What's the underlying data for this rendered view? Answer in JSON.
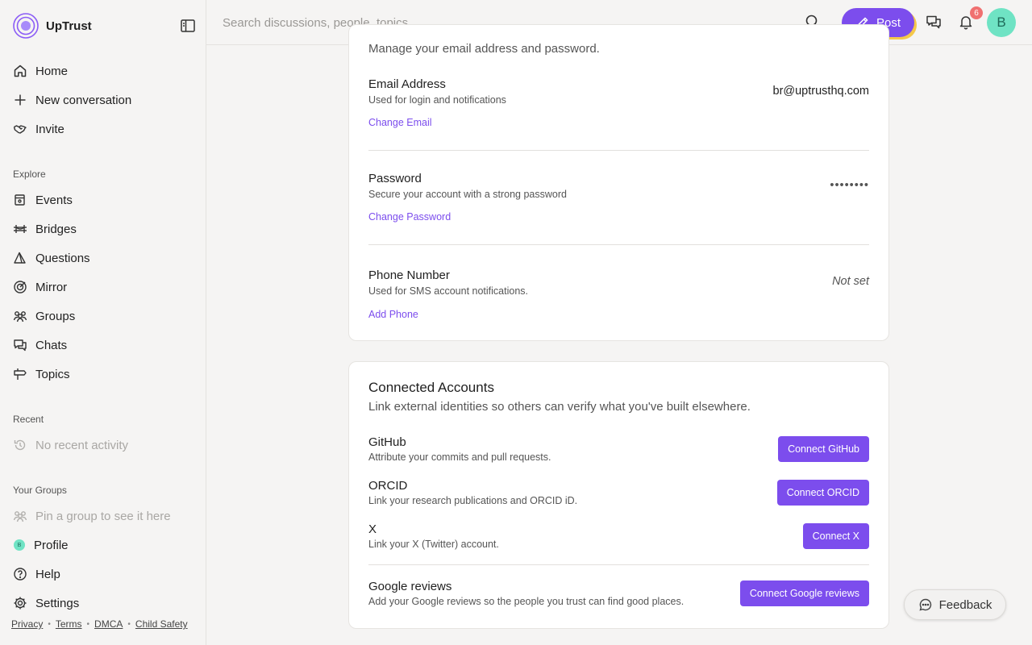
{
  "app": {
    "name": "UpTrust"
  },
  "colors": {
    "accent": "#7c4ded",
    "avatar": "#6fe3c4",
    "badge": "#f07070",
    "post_shadow": "#f5c84a"
  },
  "sidebar": {
    "main_items": [
      {
        "label": "Home",
        "icon": "home-icon"
      },
      {
        "label": "New conversation",
        "icon": "plus-icon"
      },
      {
        "label": "Invite",
        "icon": "handshake-icon"
      }
    ],
    "explore_label": "Explore",
    "explore_items": [
      {
        "label": "Events",
        "icon": "calendar-icon"
      },
      {
        "label": "Bridges",
        "icon": "bridge-icon"
      },
      {
        "label": "Questions",
        "icon": "question-icon"
      },
      {
        "label": "Mirror",
        "icon": "target-icon"
      },
      {
        "label": "Groups",
        "icon": "group-icon"
      },
      {
        "label": "Chats",
        "icon": "chat-icon"
      },
      {
        "label": "Topics",
        "icon": "signpost-icon"
      }
    ],
    "recent_label": "Recent",
    "recent_empty": "No recent activity",
    "groups_label": "Your Groups",
    "groups_empty": "Pin a group to see it here",
    "bottom_items": [
      {
        "label": "Profile",
        "icon": "avatar",
        "avatar_letter": "B"
      },
      {
        "label": "Help",
        "icon": "help-icon"
      },
      {
        "label": "Settings",
        "icon": "gear-icon"
      }
    ],
    "footer_links": [
      "Privacy",
      "Terms",
      "DMCA",
      "Child Safety"
    ]
  },
  "topbar": {
    "search_placeholder": "Search discussions, people, topics...",
    "post_label": "Post",
    "notification_count": "6",
    "avatar_letter": "B"
  },
  "account": {
    "partial_description": "Manage your email address and password.",
    "rows": [
      {
        "title": "Email Address",
        "subtitle": "Used for login and notifications",
        "action": "Change Email",
        "value": "br@uptrusthq.com"
      },
      {
        "title": "Password",
        "subtitle": "Secure your account with a strong password",
        "action": "Change Password",
        "value": "••••••••"
      },
      {
        "title": "Phone Number",
        "subtitle": "Used for SMS account notifications.",
        "action": "Add Phone",
        "value": "Not set"
      }
    ]
  },
  "connected": {
    "title": "Connected Accounts",
    "description": "Link external identities so others can verify what you've built elsewhere.",
    "items": [
      {
        "name": "GitHub",
        "desc": "Attribute your commits and pull requests.",
        "button": "Connect GitHub"
      },
      {
        "name": "ORCID",
        "desc": "Link your research publications and ORCID iD.",
        "button": "Connect ORCID"
      },
      {
        "name": "X",
        "desc": "Link your X (Twitter) account.",
        "button": "Connect X"
      },
      {
        "name": "Google reviews",
        "desc": "Add your Google reviews so the people you trust can find good places.",
        "button": "Connect Google reviews"
      }
    ]
  },
  "feedback_label": "Feedback"
}
